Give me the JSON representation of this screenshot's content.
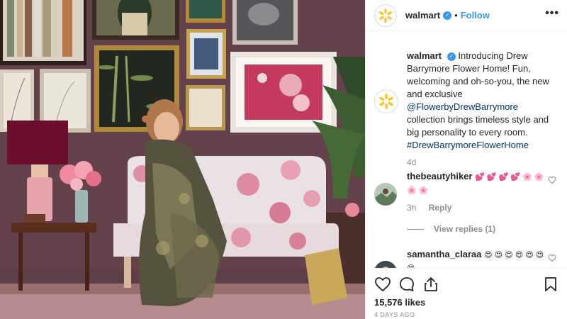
{
  "post": {
    "username": "walmart",
    "verified_symbol": "✓",
    "separator": "•",
    "follow_label": "Follow",
    "more_symbol": "•••"
  },
  "caption": {
    "username": "walmart",
    "text_1": "Introducing Drew Barrymore Flower Home! Fun, welcoming and oh-so-you, the new and exclusive",
    "mention": "@FlowerbyDrewBarrymore",
    "text_2": "collection brings timeless style and big personality to every room.",
    "hashtag": "#DrewBarrymoreFlowerHome",
    "time": "4d"
  },
  "comments": [
    {
      "username": "thebeautyhiker",
      "text": "💕 💕 💕 💕 🌸 🌸 🌸 🌸",
      "time": "3h",
      "reply_label": "Reply",
      "view_replies_label": "View replies (1)"
    },
    {
      "username": "samantha_claraa",
      "text": "😍 😍 😍 😍 😍 😍 😍"
    }
  ],
  "stats": {
    "likes": "15,576 likes",
    "ago": "4 DAYS AGO"
  },
  "colors": {
    "brand_yellow": "#ffc220",
    "link_blue": "#3897f0",
    "hashtag_blue": "#003569"
  },
  "icons": [
    "walmart-spark-logo",
    "verified-badge-icon",
    "more-options-icon",
    "heart-icon",
    "comment-icon",
    "share-icon",
    "bookmark-icon"
  ]
}
